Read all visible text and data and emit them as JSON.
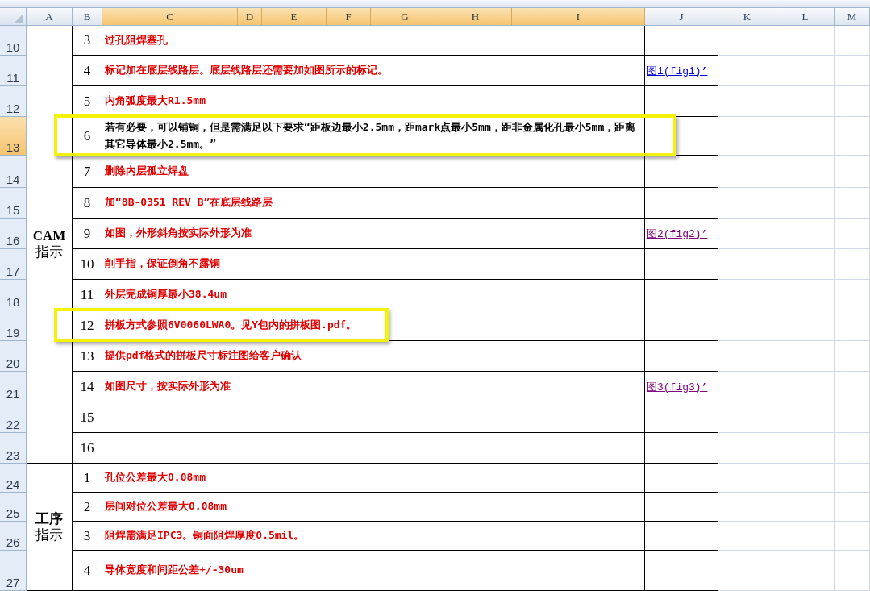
{
  "columns": [
    {
      "label": "A",
      "selected": false
    },
    {
      "label": "B",
      "selected": false
    },
    {
      "label": "C",
      "selected": true
    },
    {
      "label": "D",
      "selected": true
    },
    {
      "label": "E",
      "selected": true
    },
    {
      "label": "F",
      "selected": true
    },
    {
      "label": "G",
      "selected": true
    },
    {
      "label": "H",
      "selected": true
    },
    {
      "label": "I",
      "selected": true
    },
    {
      "label": "J",
      "selected": false
    },
    {
      "label": "K",
      "selected": false
    },
    {
      "label": "L",
      "selected": false
    },
    {
      "label": "M",
      "selected": false
    }
  ],
  "sections": [
    {
      "label_lines": [
        "CAM",
        "指示"
      ],
      "items": [
        {
          "row": "10",
          "no": "3",
          "text": "过孔阻焊塞孔",
          "color": "#e00000",
          "selected": false
        },
        {
          "row": "11",
          "no": "4",
          "text": "标记加在底层线路层。底层线路层还需要加如图所示的标记。",
          "color": "#e00000",
          "selected": false,
          "link": {
            "label": "图1(fig1)’",
            "visited": false
          }
        },
        {
          "row": "12",
          "no": "5",
          "text": "内角弧度最大R1.5mm",
          "color": "#e00000",
          "selected": false
        },
        {
          "row": "13",
          "no": "6",
          "text": "若有必要，可以铺铜，但是需满足以下要求“距板边最小2.5mm，距mark点最小5mm，距非金属化孔最小5mm，距离其它导体最小2.5mm。”",
          "color": "#000000",
          "selected": true,
          "highlighted": true
        },
        {
          "row": "14",
          "no": "7",
          "text": "删除内层孤立焊盘",
          "color": "#e00000",
          "selected": false
        },
        {
          "row": "15",
          "no": "8",
          "text": "加“8B-0351 REV B”在底层线路层",
          "color": "#e00000",
          "selected": false
        },
        {
          "row": "16",
          "no": "9",
          "text": "如图，外形斜角按实际外形为准",
          "color": "#e00000",
          "selected": false,
          "link": {
            "label": "图2(fig2)’",
            "visited": true
          }
        },
        {
          "row": "17",
          "no": "10",
          "text": "削手指，保证倒角不露铜",
          "color": "#e00000",
          "selected": false
        },
        {
          "row": "18",
          "no": "11",
          "text": "外层完成铜厚最小38.4um",
          "color": "#e00000",
          "selected": false
        },
        {
          "row": "19",
          "no": "12",
          "text": "拼板方式参照6V0060LWA0。见Y包内的拼板图.pdf。",
          "color": "#e00000",
          "selected": false,
          "highlighted": true
        },
        {
          "row": "20",
          "no": "13",
          "text": "提供pdf格式的拼板尺寸标注图给客户确认",
          "color": "#e00000",
          "selected": false
        },
        {
          "row": "21",
          "no": "14",
          "text": "如图尺寸，按实际外形为准",
          "color": "#e00000",
          "selected": false,
          "link": {
            "label": "图3(fig3)’",
            "visited": true
          }
        },
        {
          "row": "22",
          "no": "15",
          "selected": false
        },
        {
          "row": "23",
          "no": "16",
          "selected": false
        }
      ]
    },
    {
      "label_lines": [
        "工序",
        "指示"
      ],
      "items": [
        {
          "row": "24",
          "no": "1",
          "text": "孔位公差最大0.08mm",
          "color": "#e00000",
          "selected": false
        },
        {
          "row": "25",
          "no": "2",
          "text": "层间对位公差最大0.08mm",
          "color": "#e00000",
          "selected": false
        },
        {
          "row": "26",
          "no": "3",
          "text": "阻焊需满足IPC3。铜面阻焊厚度0.5mil。",
          "color": "#e00000",
          "selected": false
        },
        {
          "row": "27",
          "no": "4",
          "text": "导体宽度和间距公差+/-30um",
          "color": "#e00000",
          "selected": false
        }
      ]
    }
  ]
}
